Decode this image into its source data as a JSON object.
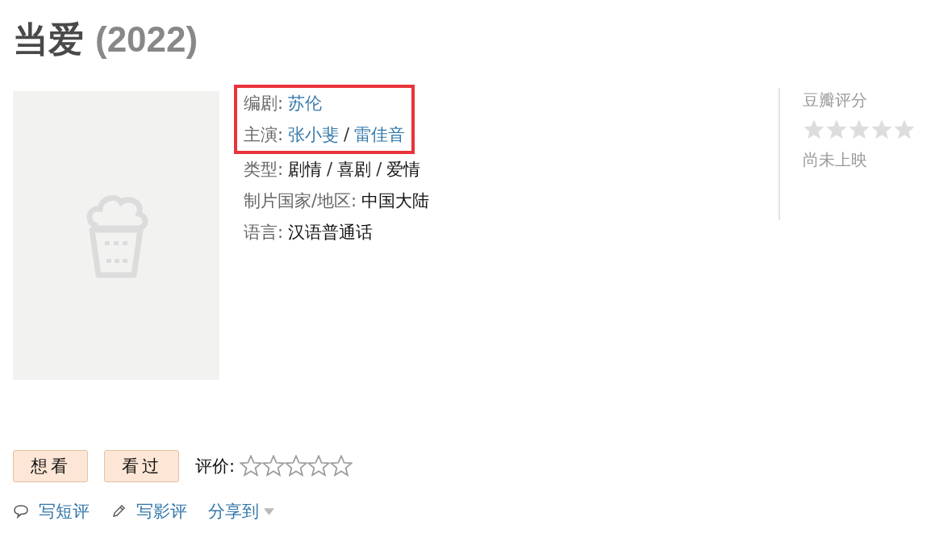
{
  "title": {
    "name": "当爱",
    "year": "(2022)"
  },
  "poster": {
    "kind": "placeholder"
  },
  "info": [
    {
      "label": "编剧:",
      "kind": "link",
      "values": [
        "苏伦"
      ],
      "highlighted": true
    },
    {
      "label": "主演:",
      "kind": "link",
      "values": [
        "张小斐",
        "雷佳音"
      ],
      "separator": "/",
      "highlighted": true
    },
    {
      "label": "类型:",
      "kind": "plain",
      "values": [
        "剧情",
        "喜剧",
        "爱情"
      ],
      "separator": "/",
      "highlighted": false
    },
    {
      "label": "制片国家/地区:",
      "kind": "plain",
      "values": [
        "中国大陆"
      ],
      "highlighted": false
    },
    {
      "label": "语言:",
      "kind": "plain",
      "values": [
        "汉语普通话"
      ],
      "highlighted": false
    }
  ],
  "rating": {
    "title": "豆瓣评分",
    "stars": 0,
    "status": "尚未上映"
  },
  "buttons": [
    "想看",
    "看过"
  ],
  "my_rating": {
    "label": "评价:",
    "stars": 0
  },
  "actions": [
    {
      "kind": "comment",
      "label": "写短评"
    },
    {
      "kind": "pencil",
      "label": "写影评"
    },
    {
      "kind": "share",
      "label": "分享到"
    }
  ]
}
